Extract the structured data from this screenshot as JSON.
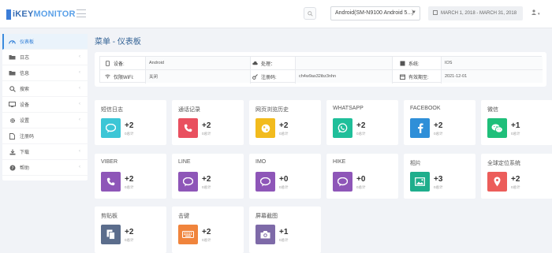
{
  "header": {
    "logo_prefix": "i",
    "logo_main": "KEY",
    "logo_suffix": "MONITOR",
    "device_select": "Android(SM-N9100 Android 5...)",
    "date_range": "MARCH 1, 2018 - MARCH 31, 2018"
  },
  "sidebar": {
    "items": [
      {
        "label": "仪表板",
        "icon": "dashboard-icon",
        "active": true,
        "has_chevron": false
      },
      {
        "label": "日志",
        "icon": "folder-icon",
        "active": false,
        "has_chevron": true
      },
      {
        "label": "信息",
        "icon": "folder-icon",
        "active": false,
        "has_chevron": true
      },
      {
        "label": "搜索",
        "icon": "search-icon",
        "active": false,
        "has_chevron": true
      },
      {
        "label": "设备",
        "icon": "monitor-icon",
        "active": false,
        "has_chevron": true
      },
      {
        "label": "设置",
        "icon": "gear-icon",
        "active": false,
        "has_chevron": true
      },
      {
        "label": "注册码",
        "icon": "document-icon",
        "active": false,
        "has_chevron": false
      },
      {
        "label": "下载",
        "icon": "download-icon",
        "active": false,
        "has_chevron": true
      },
      {
        "label": "帮助",
        "icon": "help-icon",
        "active": false,
        "has_chevron": true
      }
    ]
  },
  "page_title": "菜单 - 仪表板",
  "info": {
    "device_label": "设备:",
    "device_value": "Android",
    "process_label": "处理：",
    "process_value": "",
    "system_label": "系统:",
    "system_value": "IOS",
    "wifi_label": "仅限WiFi:",
    "wifi_value": "关闭",
    "regcode_label": "注册码:",
    "regcode_value": "ch4w9as32ibz3nhn",
    "valid_label": "有效期至:",
    "valid_value": "2021-12-01"
  },
  "tiles": [
    {
      "title": "短信日志",
      "count": "+2",
      "sub": "0总计",
      "color": "#3cc6d6",
      "icon": "chat-bubble-icon"
    },
    {
      "title": "通话记录",
      "count": "+2",
      "sub": "0总计",
      "color": "#e9505f",
      "icon": "phone-icon"
    },
    {
      "title": "网页浏览历史",
      "count": "+2",
      "sub": "0总计",
      "color": "#f2bb1d",
      "icon": "globe-icon"
    },
    {
      "title": "WHATSAPP",
      "count": "+2",
      "sub": "0总计",
      "color": "#1fbf9a",
      "icon": "whatsapp-icon"
    },
    {
      "title": "FACEBOOK",
      "count": "+2",
      "sub": "0总计",
      "color": "#2f8fd8",
      "icon": "facebook-icon"
    },
    {
      "title": "微信",
      "count": "+1",
      "sub": "0总计",
      "color": "#1fbf7a",
      "icon": "wechat-icon"
    },
    {
      "title": "VIBER",
      "count": "+2",
      "sub": "0总计",
      "color": "#8e56b8",
      "icon": "phone-icon"
    },
    {
      "title": "LINE",
      "count": "+2",
      "sub": "0总计",
      "color": "#8e56b8",
      "icon": "chat-bubble-icon"
    },
    {
      "title": "IMO",
      "count": "+0",
      "sub": "0总计",
      "color": "#8e56b8",
      "icon": "chat-bubble-icon"
    },
    {
      "title": "HIKE",
      "count": "+0",
      "sub": "0总计",
      "color": "#8e56b8",
      "icon": "chat-bubble-icon"
    },
    {
      "title": "相片",
      "count": "+3",
      "sub": "0总计",
      "color": "#1fae8c",
      "icon": "image-icon"
    },
    {
      "title": "全球定位系统",
      "count": "+2",
      "sub": "0总计",
      "color": "#ec5d5a",
      "icon": "map-pin-icon"
    },
    {
      "title": "剪贴板",
      "count": "+2",
      "sub": "0总计",
      "color": "#5b6d8c",
      "icon": "clipboard-icon"
    },
    {
      "title": "击键",
      "count": "+2",
      "sub": "0总计",
      "color": "#f0843c",
      "icon": "keyboard-icon"
    },
    {
      "title": "屏幕截图",
      "count": "+1",
      "sub": "0总计",
      "color": "#7e6aa8",
      "icon": "camera-icon"
    }
  ]
}
